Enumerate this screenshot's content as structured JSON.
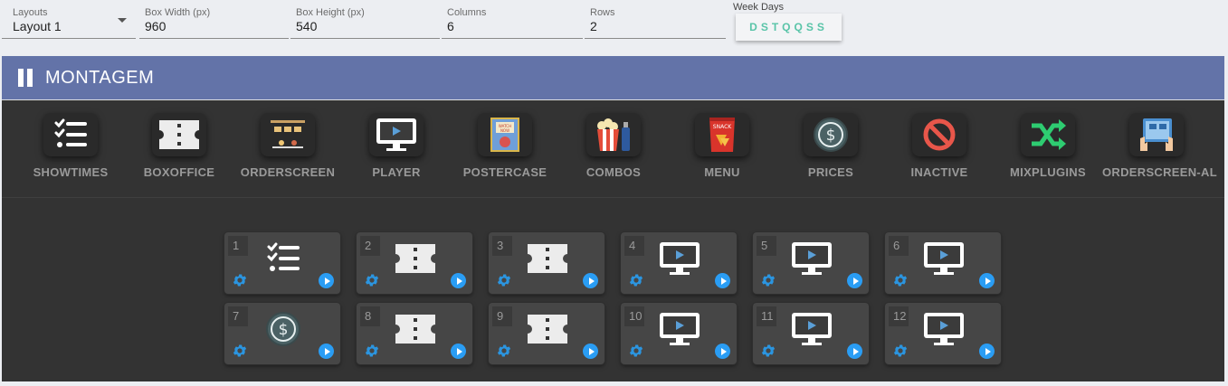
{
  "controls": {
    "layouts": {
      "label": "Layouts",
      "value": "Layout 1"
    },
    "box_width": {
      "label": "Box Width (px)",
      "value": "960"
    },
    "box_height": {
      "label": "Box Height (px)",
      "value": "540"
    },
    "columns": {
      "label": "Columns",
      "value": "6"
    },
    "rows": {
      "label": "Rows",
      "value": "2"
    },
    "week_days": {
      "label": "Week Days",
      "value": "DSTQQSS",
      "color": "#59c4a8"
    }
  },
  "header": {
    "title": "MONTAGEM",
    "color": "#6373a8"
  },
  "plugins": [
    {
      "name": "SHOWTIMES",
      "icon": "checklist-icon"
    },
    {
      "name": "BOXOFFICE",
      "icon": "ticket-icon"
    },
    {
      "name": "ORDERSCREEN",
      "icon": "orderscreen-icon"
    },
    {
      "name": "PLAYER",
      "icon": "monitor-play-icon"
    },
    {
      "name": "POSTERCASE",
      "icon": "poster-icon"
    },
    {
      "name": "COMBOS",
      "icon": "popcorn-icon"
    },
    {
      "name": "MENU",
      "icon": "snack-icon"
    },
    {
      "name": "PRICES",
      "icon": "dollar-icon"
    },
    {
      "name": "INACTIVE",
      "icon": "prohibited-icon"
    },
    {
      "name": "MIXPLUGINS",
      "icon": "shuffle-icon"
    },
    {
      "name": "ORDERSCREEN-AL",
      "icon": "touchscreen-icon"
    }
  ],
  "tiles": [
    {
      "num": "1",
      "icon": "checklist-icon"
    },
    {
      "num": "2",
      "icon": "ticket-icon"
    },
    {
      "num": "3",
      "icon": "ticket-icon"
    },
    {
      "num": "4",
      "icon": "monitor-play-icon"
    },
    {
      "num": "5",
      "icon": "monitor-play-icon"
    },
    {
      "num": "6",
      "icon": "monitor-play-icon"
    },
    {
      "num": "7",
      "icon": "dollar-icon"
    },
    {
      "num": "8",
      "icon": "ticket-icon"
    },
    {
      "num": "9",
      "icon": "ticket-icon"
    },
    {
      "num": "10",
      "icon": "monitor-play-icon"
    },
    {
      "num": "11",
      "icon": "monitor-play-icon"
    },
    {
      "num": "12",
      "icon": "monitor-play-icon"
    }
  ]
}
